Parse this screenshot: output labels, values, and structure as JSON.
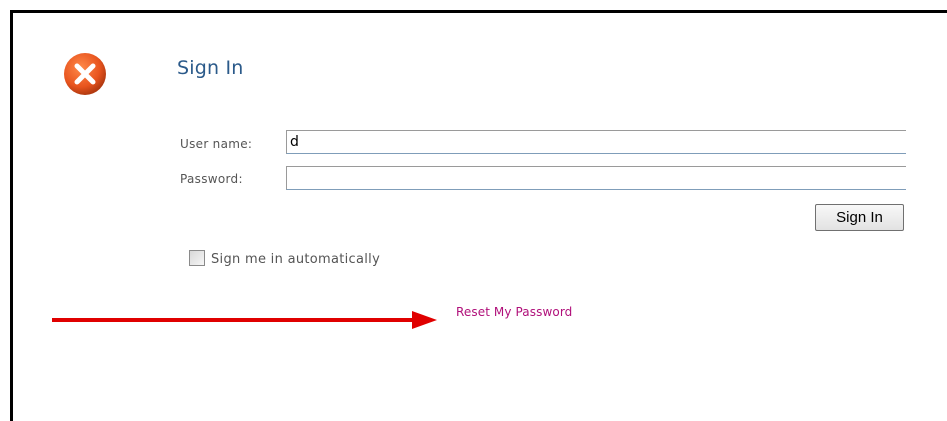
{
  "dialog": {
    "title": "Sign In",
    "icon": "error-icon",
    "accent_color": "#e8541e"
  },
  "form": {
    "username_label": "User name:",
    "username_value": "d",
    "password_label": "Password:",
    "password_value": "",
    "submit_label": "Sign In",
    "remember_label": "Sign me in automatically",
    "remember_checked": false
  },
  "links": {
    "reset_password": "Reset My Password"
  },
  "annotation": {
    "arrow_color": "#e00000"
  }
}
